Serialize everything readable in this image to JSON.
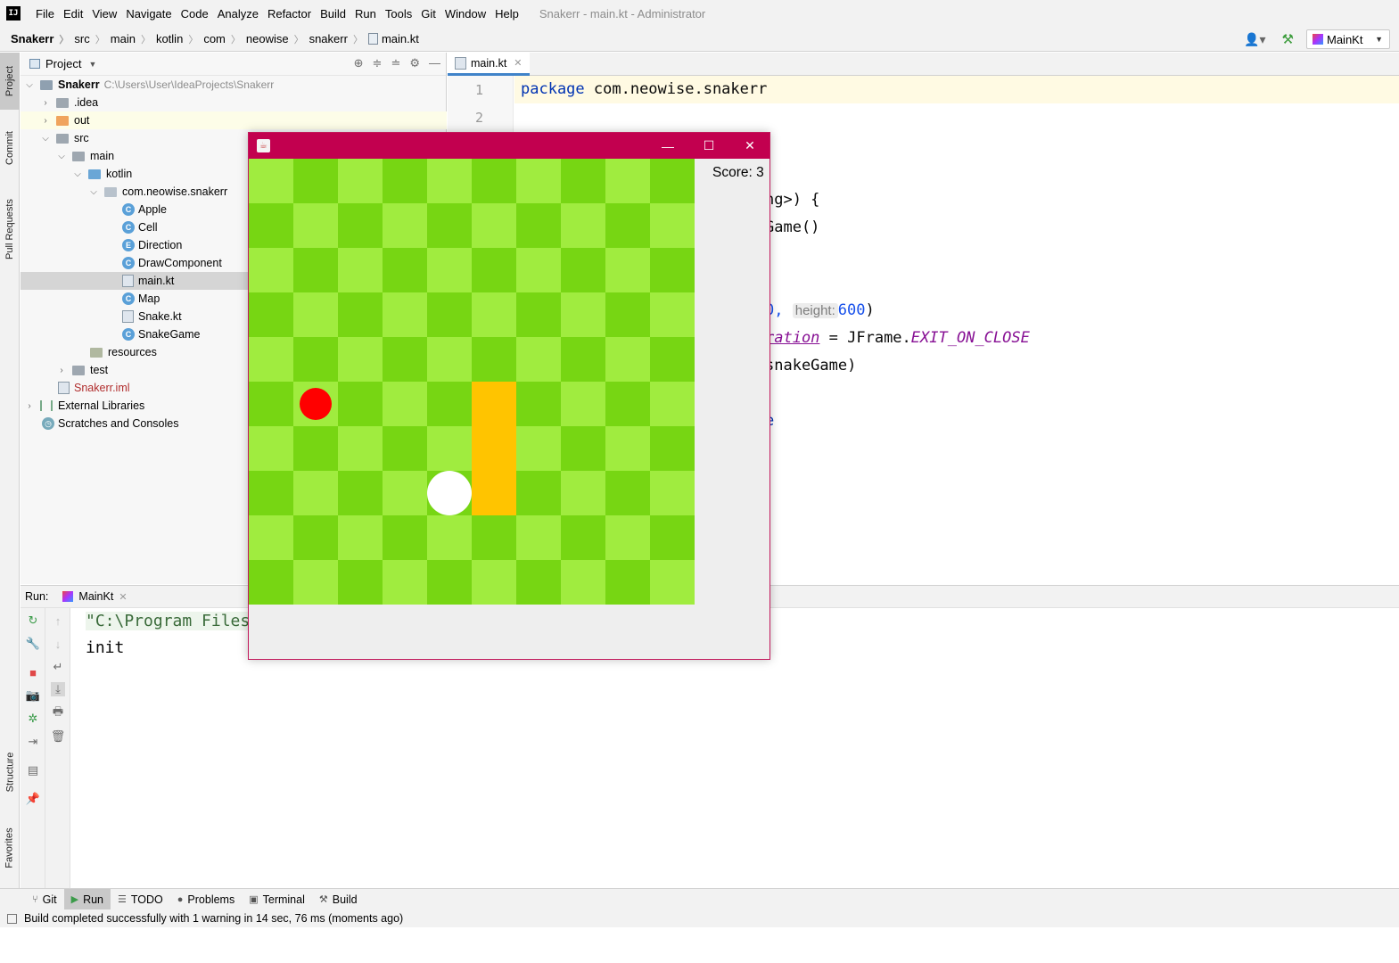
{
  "app": {
    "logo": "IJ",
    "window_title": "Snakerr - main.kt - Administrator"
  },
  "menu": [
    "File",
    "Edit",
    "View",
    "Navigate",
    "Code",
    "Analyze",
    "Refactor",
    "Build",
    "Run",
    "Tools",
    "Git",
    "Window",
    "Help"
  ],
  "breadcrumbs": [
    "Snakerr",
    "src",
    "main",
    "kotlin",
    "com",
    "neowise",
    "snakerr",
    "main.kt"
  ],
  "run_config": {
    "label": "MainKt"
  },
  "left_tabs": {
    "project": "Project",
    "commit": "Commit",
    "pull_requests": "Pull Requests",
    "structure": "Structure",
    "favorites": "Favorites"
  },
  "project_panel": {
    "title": "Project",
    "tree": [
      {
        "label": "Snakerr",
        "extra": "C:\\Users\\User\\IdeaProjects\\Snakerr"
      },
      {
        "label": ".idea"
      },
      {
        "label": "out"
      },
      {
        "label": "src"
      },
      {
        "label": "main"
      },
      {
        "label": "kotlin"
      },
      {
        "label": "com.neowise.snakerr"
      },
      {
        "label": "Apple"
      },
      {
        "label": "Cell"
      },
      {
        "label": "Direction"
      },
      {
        "label": "DrawComponent"
      },
      {
        "label": "main.kt"
      },
      {
        "label": "Map"
      },
      {
        "label": "Snake.kt"
      },
      {
        "label": "SnakeGame"
      },
      {
        "label": "resources"
      },
      {
        "label": "test"
      },
      {
        "label": "Snakerr.iml"
      },
      {
        "label": "External Libraries"
      },
      {
        "label": "Scratches and Consoles"
      }
    ]
  },
  "editor": {
    "tab": "main.kt",
    "line_numbers": [
      "1",
      "2"
    ],
    "code": {
      "l1_kw": "package",
      "l1_rest": " com.neowise.snakerr",
      "l4": "ng>) {",
      "l5": "Game()",
      "l8_a": "0,",
      "l8_hint": "height:",
      "l8_b": "600",
      "l8_c": ")",
      "l9_a": "ration",
      "l9_b": " = JFrame.",
      "l9_c": "EXIT_ON_CLOSE",
      "l10": "snakeGame)",
      "l12": "e"
    }
  },
  "run_panel": {
    "label": "Run:",
    "tab": "MainKt",
    "console": [
      "\"C:\\Program Files",
      "init"
    ]
  },
  "bottom_tabs": [
    "Git",
    "Run",
    "TODO",
    "Problems",
    "Terminal",
    "Build"
  ],
  "status": "Build completed successfully with 1 warning in 14 sec, 76 ms (moments ago)",
  "game": {
    "score_text": "Score: 3",
    "grid": {
      "cols": 10,
      "rows": 10
    },
    "colors": {
      "light": "#a0ec3f",
      "dark": "#77d613",
      "apple": "#ff0000",
      "snake": "#ffc400",
      "head": "#ffffff"
    },
    "apple": {
      "col": 1,
      "row": 5
    },
    "snake_body": [
      [
        5,
        5
      ],
      [
        5,
        6
      ],
      [
        5,
        7
      ]
    ],
    "snake_head": {
      "col": 4,
      "row": 7
    }
  }
}
